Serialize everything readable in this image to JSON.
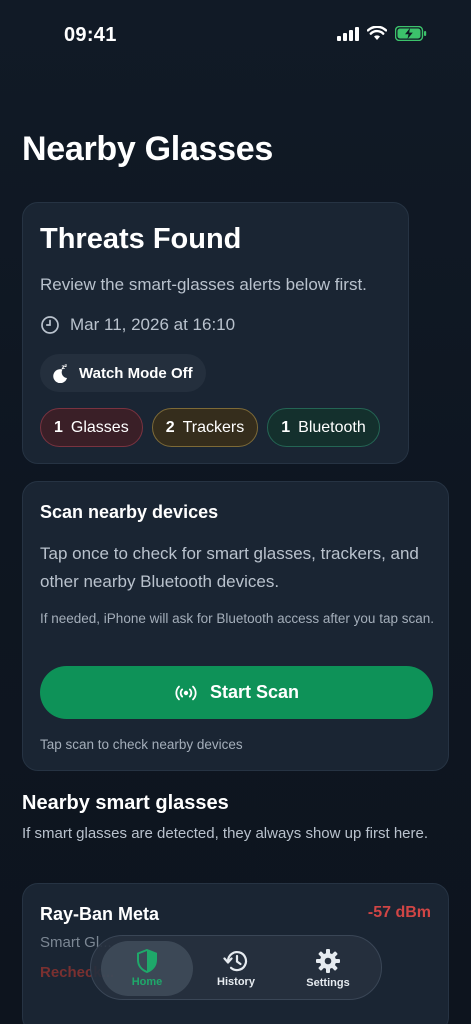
{
  "status_bar": {
    "time": "09:41"
  },
  "page": {
    "title": "Nearby Glasses"
  },
  "threats": {
    "title": "Threats Found",
    "subtitle": "Review the smart-glasses alerts below first.",
    "datetime": "Mar 11, 2026 at 16:10",
    "watch_mode": "Watch Mode Off",
    "chips": [
      {
        "count": "1",
        "label": "Glasses"
      },
      {
        "count": "2",
        "label": "Trackers"
      },
      {
        "count": "1",
        "label": "Bluetooth"
      }
    ]
  },
  "scan": {
    "title": "Scan nearby devices",
    "description": "Tap once to check for smart glasses, trackers, and other nearby Bluetooth devices.",
    "note": "If needed, iPhone will ask for Bluetooth access after you tap scan.",
    "button": "Start Scan",
    "hint": "Tap scan to check nearby devices"
  },
  "nearby": {
    "title": "Nearby smart glasses",
    "description": "If smart glasses are detected, they always show up first here.",
    "devices": [
      {
        "name": "Ray-Ban Meta",
        "signal": "-57 dBm",
        "type": "Smart Gl...",
        "status": "Recheck..."
      }
    ]
  },
  "tabs": [
    {
      "label": "Home",
      "icon": "shield-icon"
    },
    {
      "label": "History",
      "icon": "history-icon"
    },
    {
      "label": "Settings",
      "icon": "gear-icon"
    }
  ],
  "colors": {
    "background": "#0f1722",
    "card": "#1a2533",
    "accent_green": "#0e9258",
    "alert_red": "#d04545"
  }
}
